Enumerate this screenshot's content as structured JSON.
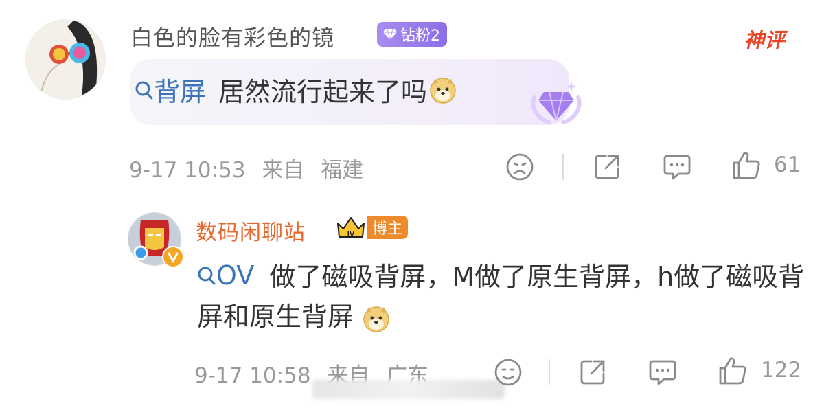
{
  "comment": {
    "username": "白色的脸有彩色的镜",
    "fan_badge": "钻粉2",
    "tag": "神评",
    "topic": "背屏",
    "text": "居然流行起来了吗",
    "time": "9-17 10:53",
    "from_label": "来自",
    "location": "福建",
    "likes": "61"
  },
  "reply": {
    "username": "数码闲聊站",
    "badge": "博主",
    "topic": "OV",
    "text": "做了磁吸背屏，M做了原生背屏，h做了磁吸背屏和原生背屏",
    "time": "9-17 10:58",
    "from_label": "来自",
    "location": "广东",
    "likes": "122"
  },
  "icons": [
    "sad-face-icon",
    "share-icon",
    "comment-icon",
    "like-icon",
    "search-icon",
    "gem-icon",
    "doge-emoji",
    "crown-icon",
    "verified-icon"
  ],
  "colors": {
    "link": "#3b74b8",
    "username_reply": "#e8692f",
    "meta": "#999999",
    "shenping": "#e8462a",
    "fan_badge": "#9b7cee"
  }
}
